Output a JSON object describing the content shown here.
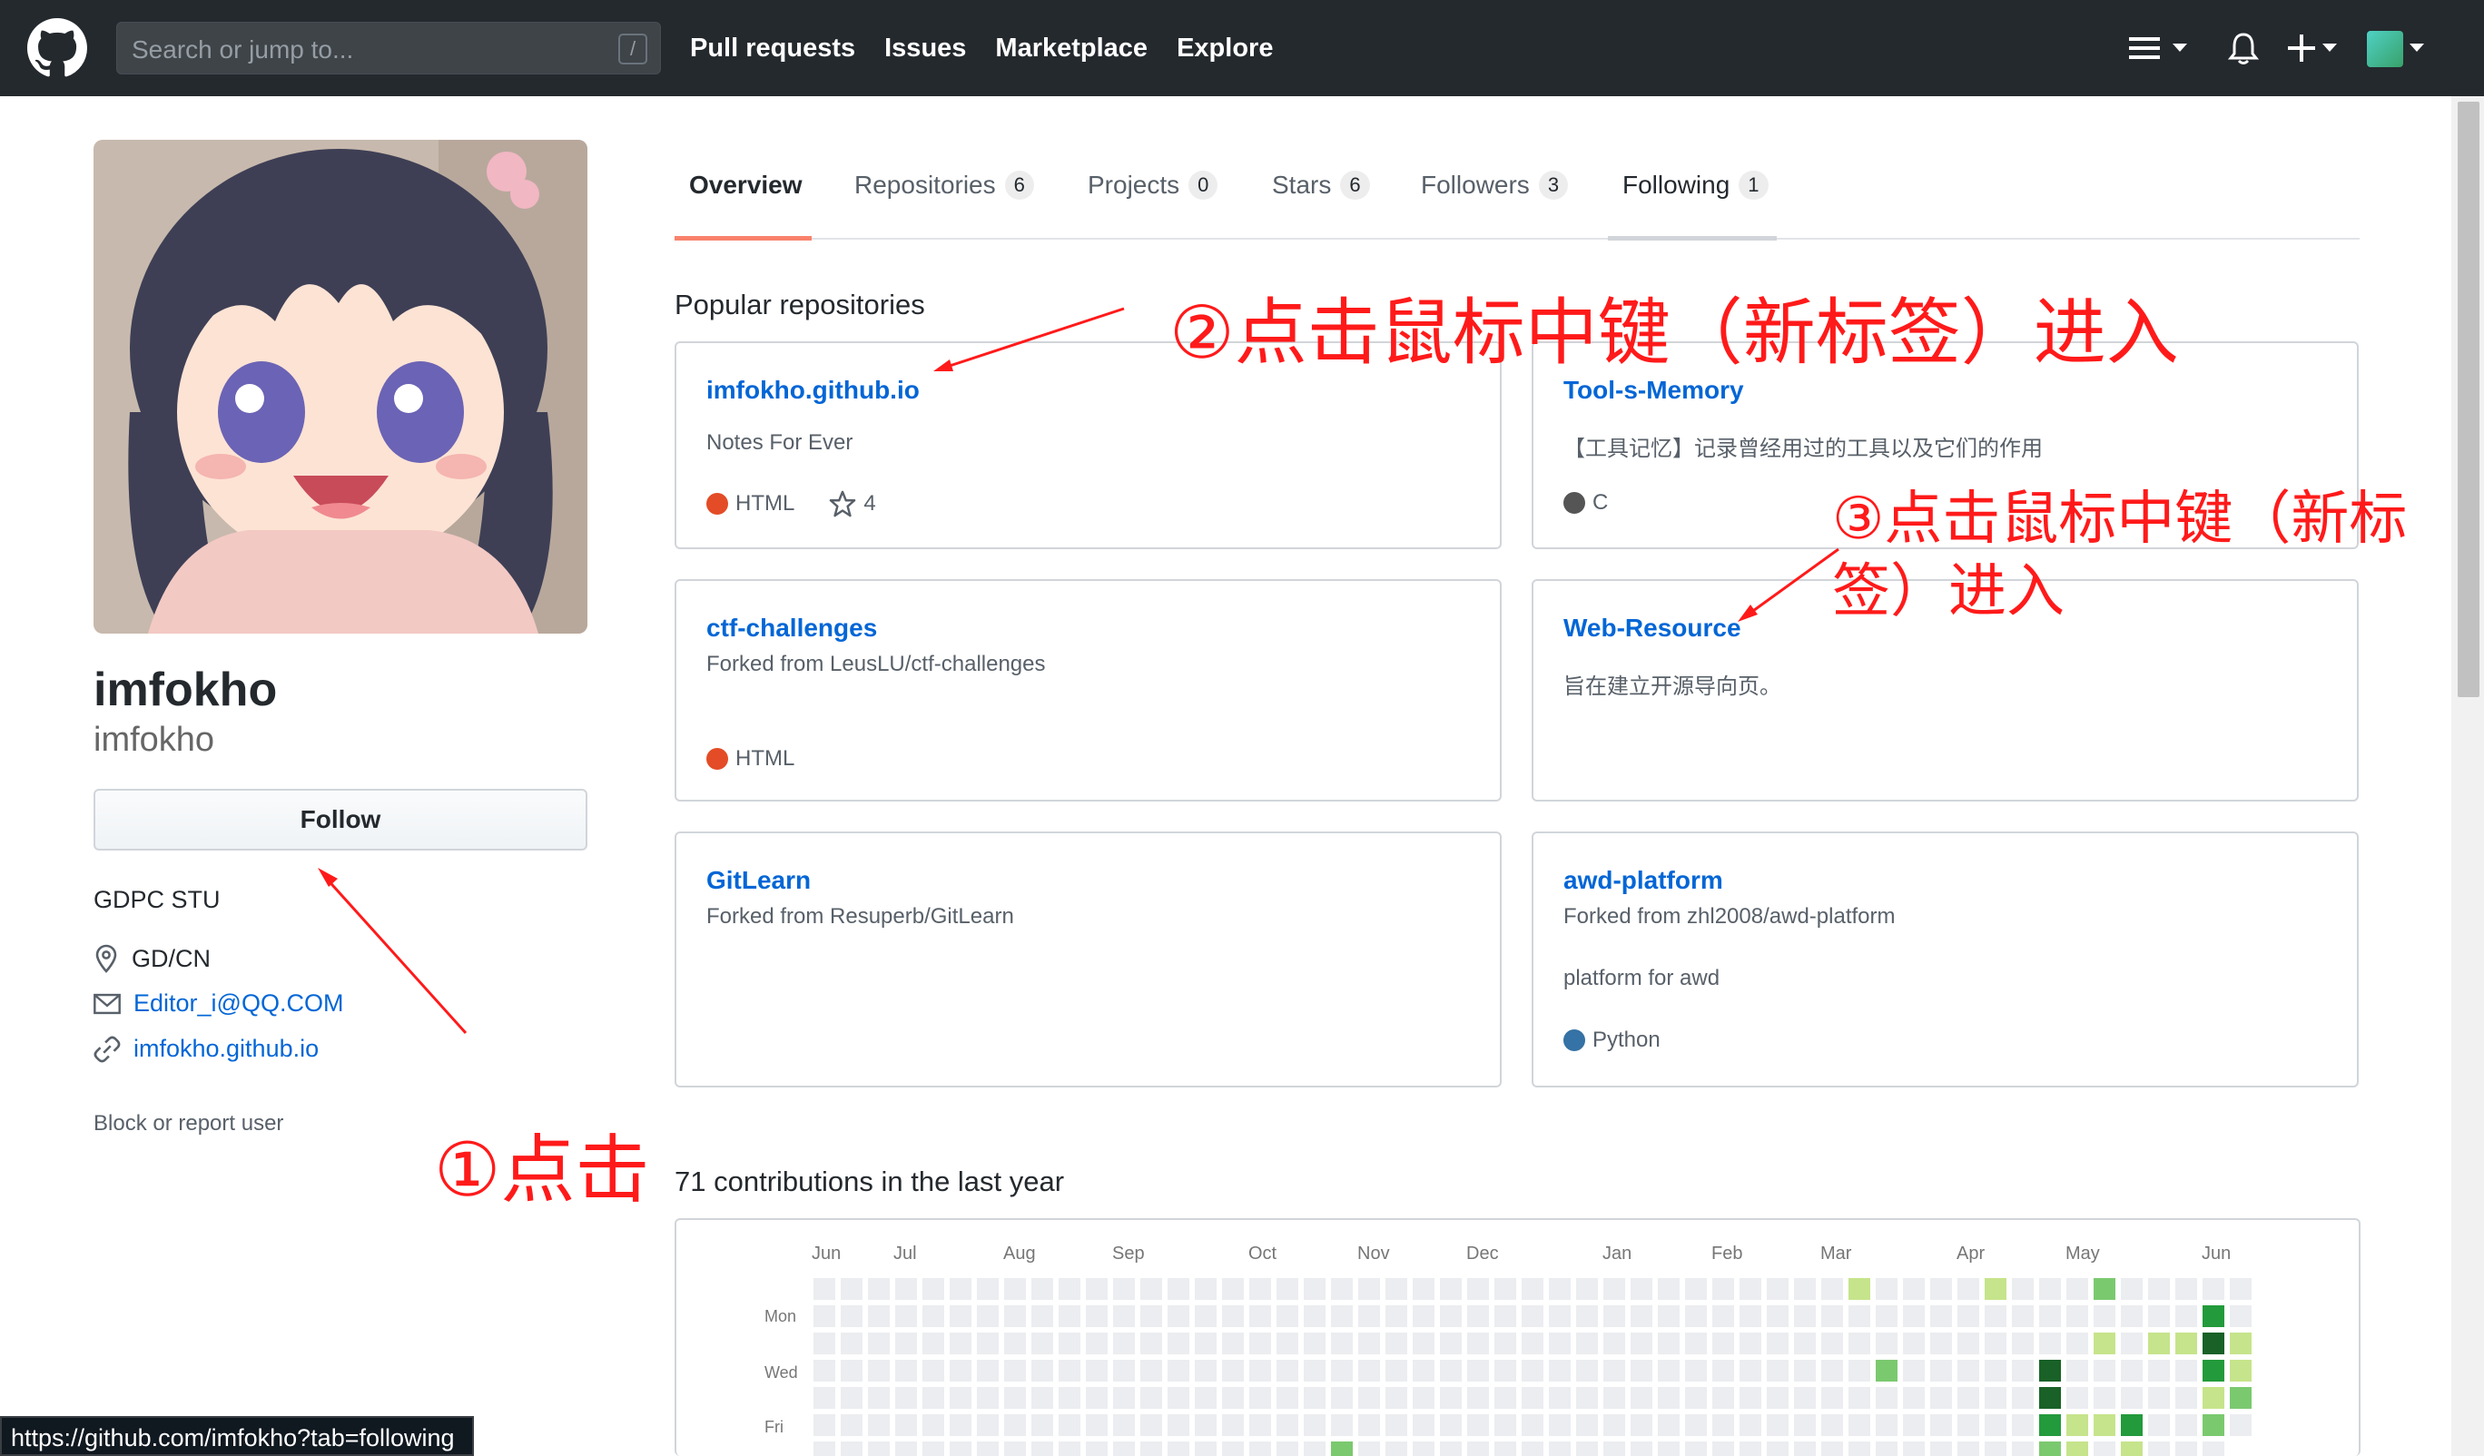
{
  "header": {
    "search_placeholder": "Search or jump to...",
    "search_shortcut": "/",
    "nav": [
      "Pull requests",
      "Issues",
      "Marketplace",
      "Explore"
    ]
  },
  "profile": {
    "fullname": "imfokho",
    "username": "imfokho",
    "follow_label": "Follow",
    "bio": "GDPC STU",
    "location": "GD/CN",
    "email": "Editor_i@QQ.COM",
    "website": "imfokho.github.io",
    "block_label": "Block or report user"
  },
  "tabs": [
    {
      "label": "Overview",
      "count": ""
    },
    {
      "label": "Repositories",
      "count": "6"
    },
    {
      "label": "Projects",
      "count": "0"
    },
    {
      "label": "Stars",
      "count": "6"
    },
    {
      "label": "Followers",
      "count": "3"
    },
    {
      "label": "Following",
      "count": "1"
    }
  ],
  "popular_title": "Popular repositories",
  "repos": [
    {
      "name": "imfokho.github.io",
      "desc": "Notes For Ever",
      "lang": "HTML",
      "lang_color": "#e34c26",
      "stars": "4"
    },
    {
      "name": "Tool-s-Memory",
      "desc": "【工具记忆】记录曾经用过的工具以及它们的作用",
      "lang": "C",
      "lang_color": "#555555"
    },
    {
      "name": "ctf-challenges",
      "desc": "Forked from LeusLU/ctf-challenges",
      "lang": "HTML",
      "lang_color": "#e34c26"
    },
    {
      "name": "Web-Resource",
      "desc": "旨在建立开源导向页。"
    },
    {
      "name": "GitLearn",
      "desc": "Forked from Resuperb/GitLearn"
    },
    {
      "name": "awd-platform",
      "desc": "Forked from zhl2008/awd-platform",
      "desc2": "platform for awd",
      "lang": "Python",
      "lang_color": "#3572A5"
    }
  ],
  "contributions_title": "71 contributions in the last year",
  "contrib_months": [
    "Jun",
    "Jul",
    "Aug",
    "Sep",
    "Oct",
    "Nov",
    "Dec",
    "Jan",
    "Feb",
    "Mar",
    "Apr",
    "May",
    "Jun"
  ],
  "contrib_days": [
    "Mon",
    "Wed",
    "Fri"
  ],
  "annotations": {
    "a1": "①点击",
    "a2": "②点击鼠标中键（新标签）进入",
    "a3_line1": "③点击鼠标中键（新标",
    "a3_line2": "签）进入"
  },
  "status_url": "https://github.com/imfokho?tab=following",
  "colors": {
    "accent_tab": "#f9826c",
    "following_underline": "#d1d5da",
    "annotation": "#ff1a1a"
  }
}
